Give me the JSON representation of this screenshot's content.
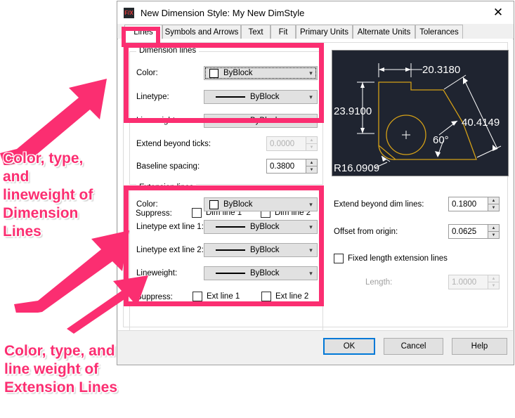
{
  "window": {
    "title": "New Dimension Style: My New DimStyle",
    "icon": "fx-app-icon",
    "close_label": "✕"
  },
  "tabs": [
    {
      "label": "Lines",
      "active": true
    },
    {
      "label": "Symbols and Arrows",
      "active": false
    },
    {
      "label": "Text",
      "active": false
    },
    {
      "label": "Fit",
      "active": false
    },
    {
      "label": "Primary Units",
      "active": false
    },
    {
      "label": "Alternate Units",
      "active": false
    },
    {
      "label": "Tolerances",
      "active": false
    }
  ],
  "dimension_lines": {
    "group_title": "Dimension lines",
    "color": {
      "label": "Color:",
      "value": "ByBlock",
      "swatch": "#ffffff"
    },
    "linetype": {
      "label": "Linetype:",
      "value": "ByBlock"
    },
    "lineweight": {
      "label": "Lineweight:",
      "value": "ByBlock"
    },
    "extend_beyond_ticks": {
      "label": "Extend beyond ticks:",
      "value": "0.0000",
      "disabled": true
    },
    "baseline_spacing": {
      "label": "Baseline spacing:",
      "value": "0.3800",
      "disabled": false
    },
    "suppress": {
      "label": "Suppress:",
      "dim_line_1": "Dim line 1",
      "dim_line_2": "Dim line 2"
    }
  },
  "extension_lines": {
    "group_title": "Extension lines",
    "color": {
      "label": "Color:",
      "value": "ByBlock",
      "swatch": "#ffffff"
    },
    "linetype_ext_1": {
      "label": "Linetype ext line 1:",
      "value": "ByBlock"
    },
    "linetype_ext_2": {
      "label": "Linetype ext line 2:",
      "value": "ByBlock"
    },
    "lineweight": {
      "label": "Lineweight:",
      "value": "ByBlock"
    },
    "suppress": {
      "label": "Suppress:",
      "ext_line_1": "Ext line 1",
      "ext_line_2": "Ext line 2"
    },
    "extend_beyond_dim_lines": {
      "label": "Extend beyond dim lines:",
      "value": "0.1800"
    },
    "offset_from_origin": {
      "label": "Offset from origin:",
      "value": "0.0625"
    },
    "fixed_length": {
      "label": "Fixed length extension lines",
      "checked": false
    },
    "length": {
      "label": "Length:",
      "value": "1.0000",
      "disabled": true
    }
  },
  "preview": {
    "dim_top": "20.3180",
    "dim_left": "23.9100",
    "dim_diagonal": "40.4149",
    "dim_angle": "60°",
    "dim_radius": "R16.0909",
    "bg_color": "#1f2430",
    "geometry_color": "#d4a017",
    "dim_color": "#ffffff"
  },
  "footer": {
    "ok": "OK",
    "cancel": "Cancel",
    "help": "Help"
  },
  "annotations": {
    "accent_color": "#FB2E71",
    "top_note": "Color, type,\nand\nlineweight of\nDimension\nLines",
    "bottom_note": "Color, type, and\nline weight of\nExtension Lines"
  }
}
